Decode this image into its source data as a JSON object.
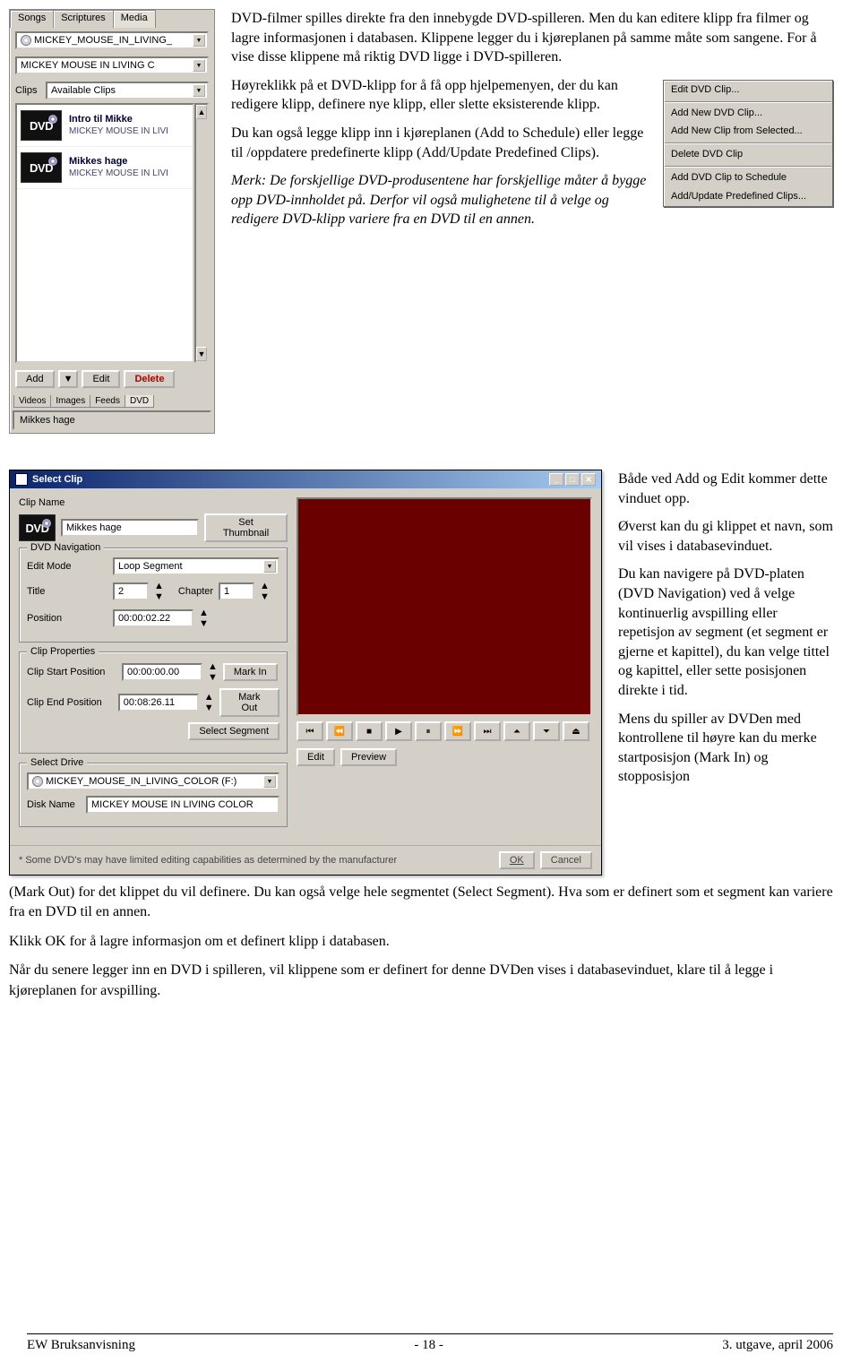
{
  "media_panel": {
    "tabs": [
      "Songs",
      "Scriptures",
      "Media"
    ],
    "active_tab": "Media",
    "drive_value": "MICKEY_MOUSE_IN_LIVING_",
    "volume_value": "MICKEY MOUSE IN LIVING C",
    "clips_label": "Clips",
    "clips_value": "Available Clips",
    "items": [
      {
        "thumb": "DVD",
        "title": "Intro til Mikke",
        "sub": "MICKEY MOUSE IN LIVI"
      },
      {
        "thumb": "DVD",
        "title": "Mikkes hage",
        "sub": "MICKEY MOUSE IN LIVI"
      }
    ],
    "buttons": {
      "add": "Add",
      "edit": "Edit",
      "delete": "Delete"
    },
    "bottom_tabs": [
      "Videos",
      "Images",
      "Feeds",
      "DVD"
    ],
    "bottom_active": "DVD",
    "status": "Mikkes hage"
  },
  "top_text": {
    "p1": "DVD-filmer spilles direkte fra den innebygde DVD-spilleren. Men du kan editere klipp fra filmer og lagre informasjonen i databasen. Klippene legger du i kjøreplanen på samme måte som sangene. For å vise disse klippene må riktig DVD ligge i DVD-spilleren.",
    "p2": "Høyreklikk på et DVD-klipp for å få opp hjelpemenyen, der du kan redigere klipp, definere nye klipp, eller slette eksisterende klipp.",
    "p3": "Du kan også legge klipp inn i kjøreplanen (Add to Schedule) eller legge til /oppdatere predefinerte klipp (Add/Update Predefined Clips).",
    "p4": "Merk: De forskjellige DVD-produsentene har forskjellige måter å bygge opp DVD-innholdet på. Derfor vil også mulighetene til å velge og redigere DVD-klipp variere fra en DVD til en annen."
  },
  "context_menu": {
    "items": [
      "Edit DVD Clip...",
      "-",
      "Add New DVD Clip...",
      "Add New Clip from Selected...",
      "-",
      "Delete DVD Clip",
      "-",
      "Add DVD Clip to Schedule",
      "Add/Update Predefined Clips..."
    ]
  },
  "select_clip": {
    "title": "Select Clip",
    "clip_name_label": "Clip Name",
    "clip_name_value": "Mikkes hage",
    "set_thumbnail": "Set Thumbnail",
    "nav_legend": "DVD Navigation",
    "edit_mode_label": "Edit Mode",
    "edit_mode_value": "Loop Segment",
    "title_label": "Title",
    "title_value": "2",
    "chapter_label": "Chapter",
    "chapter_value": "1",
    "position_label": "Position",
    "position_value": "00:00:02.22",
    "props_legend": "Clip Properties",
    "start_label": "Clip Start Position",
    "start_value": "00:00:00.00",
    "mark_in": "Mark In",
    "end_label": "Clip End Position",
    "end_value": "00:08:26.11",
    "mark_out": "Mark Out",
    "select_segment": "Select Segment",
    "drive_legend": "Select Drive",
    "drive_value": "MICKEY_MOUSE_IN_LIVING_COLOR (F:)",
    "disk_name_label": "Disk Name",
    "disk_name_value": "MICKEY MOUSE IN LIVING COLOR",
    "edit_btn": "Edit",
    "preview_btn": "Preview",
    "ok": "OK",
    "cancel": "Cancel",
    "disclaimer": "* Some DVD's may have limited editing capabilities as determined by the manufacturer"
  },
  "mid_text": {
    "p1": "Både ved Add og Edit kommer dette vinduet opp.",
    "p2": "Øverst kan du gi klippet et navn, som vil vises i databasevinduet.",
    "p3": "Du kan navigere på DVD-platen (DVD Navigation) ved å velge kontinuerlig avspilling eller repetisjon av segment (et segment er gjerne et kapittel), du kan velge tittel og kapittel, eller sette posisjonen direkte i tid.",
    "p4a": "Mens du spiller av DVDen med kontrollene til høyre kan du merke startposisjon (Mark In) og stopposisjon",
    "p4b": "(Mark Out) for det klippet du vil definere. Du kan også velge hele segmentet (Select Segment). Hva som er definert som et segment kan variere fra en DVD til en annen.",
    "p5": "Klikk OK for å lagre informasjon om et definert klipp i databasen.",
    "p6": "Når du senere legger inn en DVD i spilleren, vil klippene som er definert for denne DVDen vises i databasevinduet, klare til å legge i kjøreplanen for avspilling."
  },
  "footer": {
    "left": "EW Bruksanvisning",
    "center": "- 18 -",
    "right": "3. utgave, april 2006"
  }
}
